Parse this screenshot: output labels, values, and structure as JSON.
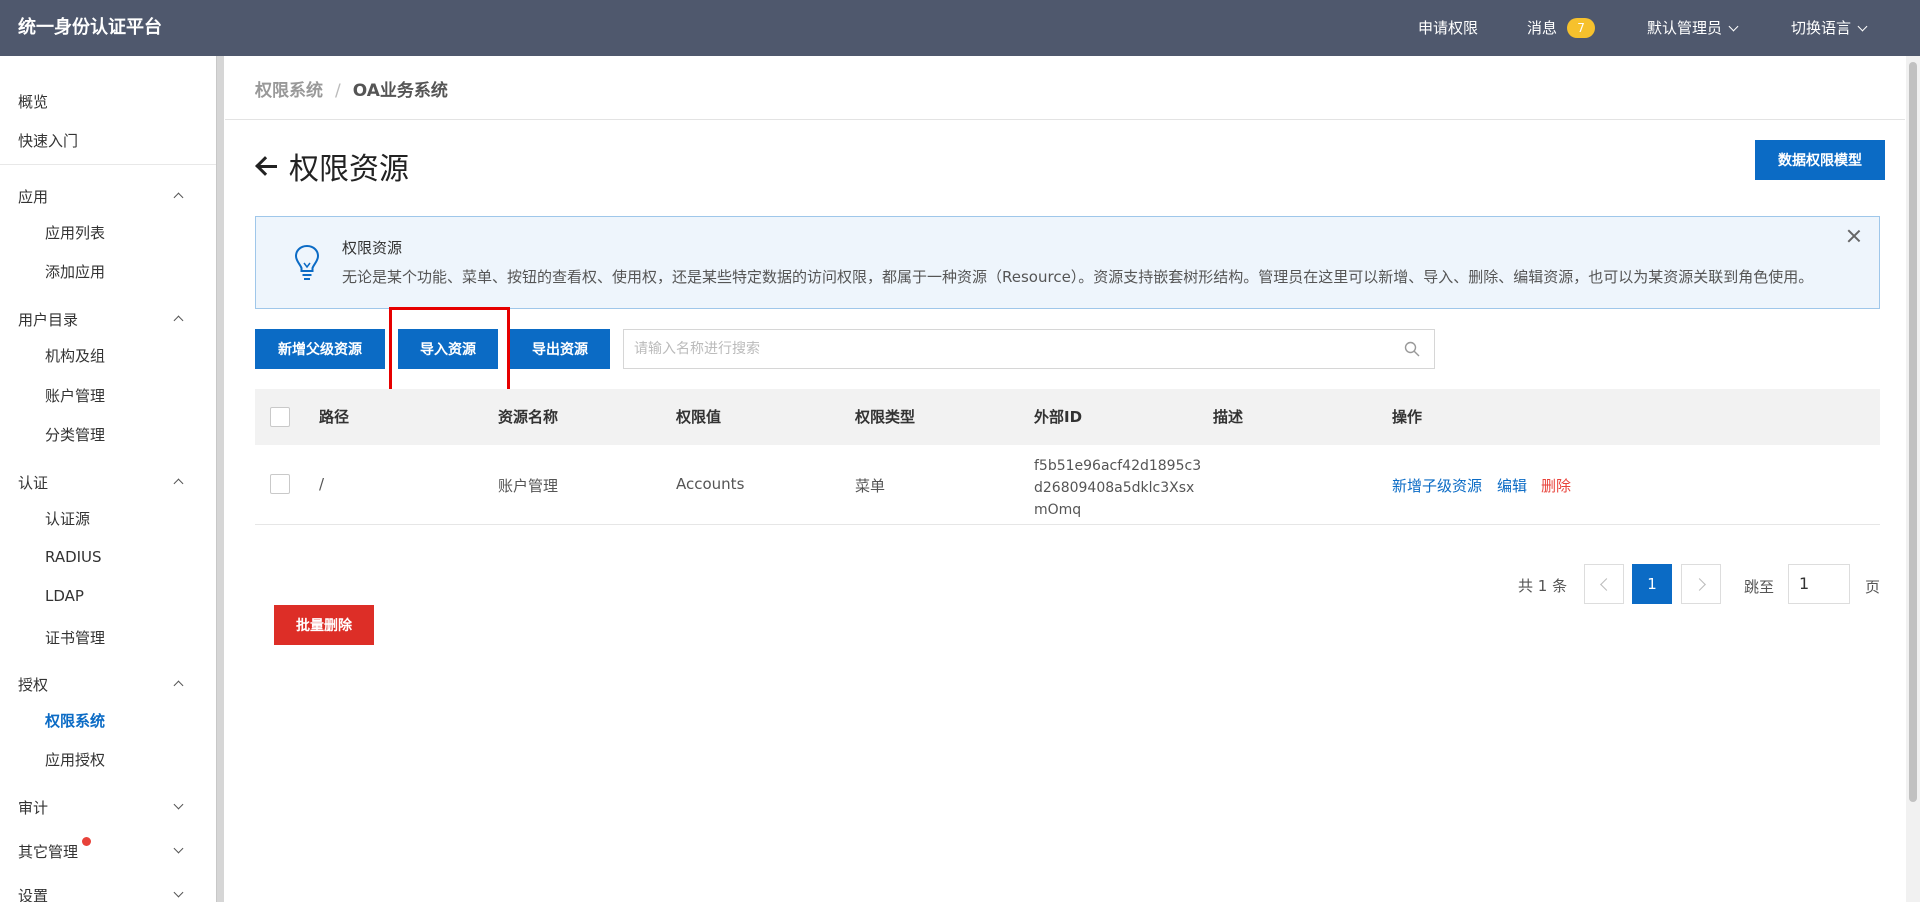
{
  "topbar": {
    "brand": "统一身份认证平台",
    "apply": "申请权限",
    "messages": "消息",
    "message_count": "7",
    "admin": "默认管理员",
    "language": "切换语言"
  },
  "sidebar": {
    "overview": "概览",
    "quickstart": "快速入门",
    "apps": "应用",
    "app_list": "应用列表",
    "add_app": "添加应用",
    "user_dir": "用户目录",
    "org": "机构及组",
    "accounts": "账户管理",
    "category": "分类管理",
    "auth": "认证",
    "auth_source": "认证源",
    "radius": "RADIUS",
    "ldap": "LDAP",
    "cert": "证书管理",
    "authorize": "授权",
    "perm_system": "权限系统",
    "app_auth": "应用授权",
    "audit": "审计",
    "other": "其它管理",
    "settings": "设置"
  },
  "breadcrumb": {
    "root": "权限系统",
    "separator": "/",
    "current": "OA业务系统"
  },
  "page": {
    "title": "权限资源",
    "data_model_button": "数据权限模型"
  },
  "info": {
    "title": "权限资源",
    "text": "无论是某个功能、菜单、按钮的查看权、使用权，还是某些特定数据的访问权限，都属于一种资源（Resource）。资源支持嵌套树形结构。管理员在这里可以新增、导入、删除、编辑资源，也可以为某资源关联到角色使用。"
  },
  "toolbar": {
    "add_parent": "新增父级资源",
    "import": "导入资源",
    "export": "导出资源",
    "search_placeholder": "请输入名称进行搜索"
  },
  "table": {
    "headers": [
      "路径",
      "资源名称",
      "权限值",
      "权限类型",
      "外部ID",
      "描述",
      "操作"
    ],
    "rows": [
      {
        "path": "/",
        "name": "账户管理",
        "value": "Accounts",
        "type": "菜单",
        "external_id": "f5b51e96acf42d1895c3d26809408a5dklc3XsxmOmq",
        "description": "",
        "actions": [
          "新增子级资源",
          "编辑",
          "删除"
        ]
      }
    ]
  },
  "pager": {
    "total": "共 1 条",
    "current": "1",
    "jump_label": "跳至",
    "jump_value": "1",
    "page_label": "页"
  },
  "bulk_delete": "批量删除",
  "colors": {
    "topbar": "#4f586d",
    "primary": "#0b6bc5",
    "danger": "#dd2e27",
    "badge": "#f6c12d",
    "highlight": "#e60000"
  }
}
